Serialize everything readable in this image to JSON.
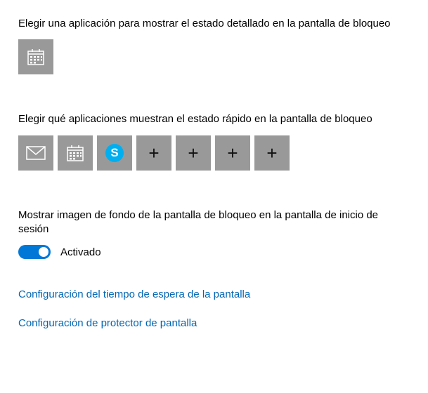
{
  "colors": {
    "accent": "#0078D7",
    "link": "#0066B4",
    "tile": "#999999",
    "skype": "#00AFF0"
  },
  "detailed": {
    "label": "Elegir una aplicación para mostrar el estado detallado en la pantalla de bloqueo",
    "slots": [
      {
        "icon": "calendar-icon"
      }
    ]
  },
  "quick": {
    "label": "Elegir qué aplicaciones muestran el estado rápido en la pantalla de bloqueo",
    "slots": [
      {
        "icon": "mail-icon"
      },
      {
        "icon": "calendar-icon"
      },
      {
        "icon": "skype-icon",
        "letter": "S"
      },
      {
        "icon": "plus-icon",
        "glyph": "+"
      },
      {
        "icon": "plus-icon",
        "glyph": "+"
      },
      {
        "icon": "plus-icon",
        "glyph": "+"
      },
      {
        "icon": "plus-icon",
        "glyph": "+"
      }
    ]
  },
  "background_toggle": {
    "label": "Mostrar imagen de fondo de la pantalla de bloqueo en la pantalla de inicio de sesión",
    "state_text": "Activado",
    "on": true
  },
  "links": {
    "timeout": "Configuración del tiempo de espera de la pantalla",
    "screensaver": "Configuración de protector de pantalla"
  }
}
